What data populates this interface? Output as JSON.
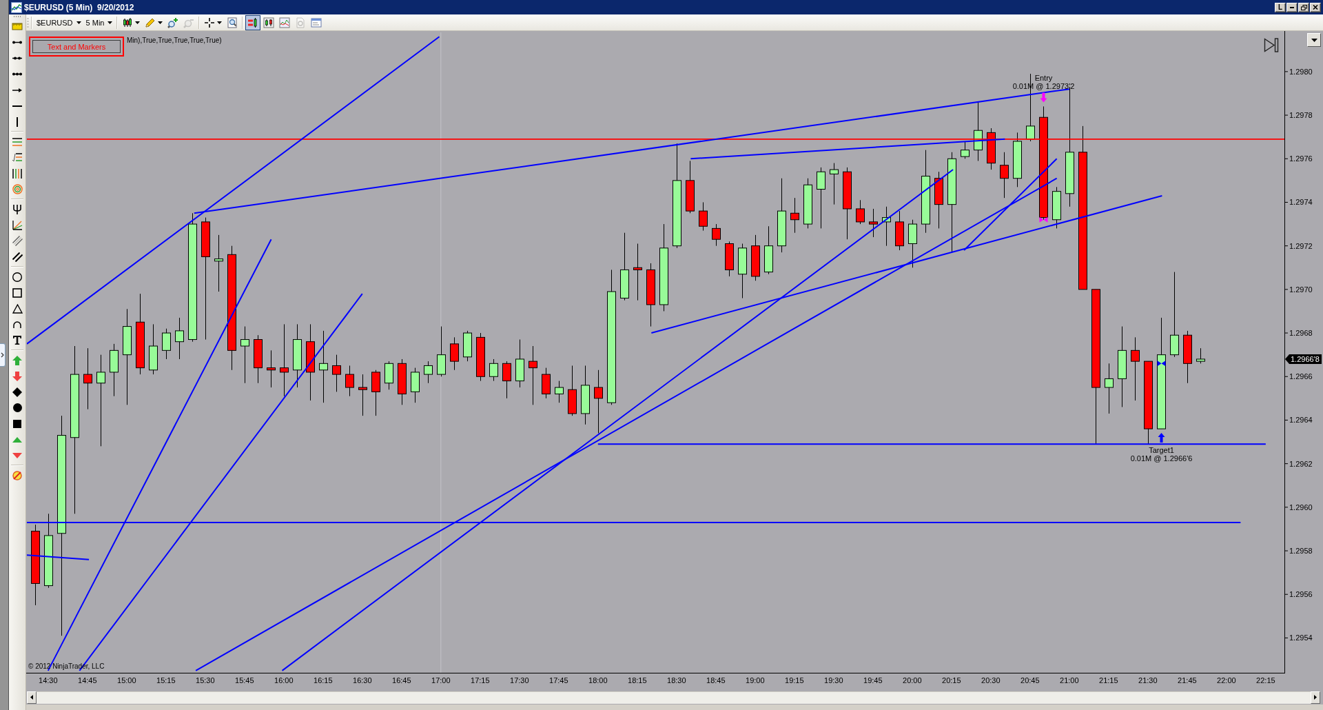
{
  "window": {
    "title": "$EURUSD (5 Min)  9/20/2012",
    "link_label": "L"
  },
  "toolbar": {
    "instrument": "$EURUSD",
    "interval": "5 Min",
    "tools": [
      {
        "kind": "chart-style",
        "selected": false,
        "disabled": false
      },
      {
        "kind": "drawing",
        "selected": false,
        "disabled": false
      },
      {
        "kind": "zoom-in",
        "selected": false,
        "disabled": false
      },
      {
        "kind": "zoom-out",
        "selected": false,
        "disabled": true
      },
      {
        "kind": "crosshair",
        "selected": false,
        "disabled": false
      },
      {
        "kind": "data-box",
        "selected": false,
        "disabled": false
      },
      {
        "kind": "chart-trader",
        "selected": true,
        "disabled": false
      },
      {
        "kind": "bars",
        "selected": false,
        "disabled": false
      },
      {
        "kind": "indicators",
        "selected": false,
        "disabled": false
      },
      {
        "kind": "strategies",
        "selected": false,
        "disabled": true
      },
      {
        "kind": "properties",
        "selected": false,
        "disabled": false
      }
    ]
  },
  "chart": {
    "button": {
      "label": "Text and Markers"
    },
    "copyright": "© 2012 NinjaTrader, LLC",
    "price_tag": "1.2966'8",
    "executions": [
      {
        "kind": "sell",
        "label": "Entry",
        "text": "0.01M @ 1.2973'2",
        "color": "#ff00ff"
      },
      {
        "kind": "buy",
        "label": "Target1",
        "text": "0.01M @ 1.2966'6",
        "color": "#0000ff"
      }
    ],
    "chart_data": {
      "type": "candlestick",
      "title": "Min),True,True,True,True,True)",
      "x": [
        14.4167,
        14.5,
        14.5833,
        14.6667,
        14.75,
        14.8333,
        14.9167,
        15,
        15.0833,
        15.1667,
        15.25,
        15.3333,
        15.4167,
        15.5,
        15.5833,
        15.6667,
        15.75,
        15.8333,
        15.9167,
        16,
        16.0833,
        16.1667,
        16.25,
        16.3333,
        16.4167,
        16.5,
        16.5833,
        16.6667,
        16.75,
        16.8333,
        16.9167,
        17,
        17.0833,
        17.1667,
        17.25,
        17.3333,
        17.4167,
        17.5,
        17.5833,
        17.6667,
        17.75,
        17.8333,
        17.9167,
        18,
        18.0833,
        18.1667,
        18.25,
        18.3333,
        18.4167,
        18.5,
        18.5833,
        18.6667,
        18.75,
        18.8333,
        18.9167,
        19,
        19.0833,
        19.1667,
        19.25,
        19.3333,
        19.4167,
        19.5,
        19.5833,
        19.6667,
        19.75,
        19.8333,
        19.9167,
        20,
        20.0833,
        20.1667,
        20.25,
        20.3333,
        20.4167,
        20.5,
        20.5833,
        20.6667,
        20.75,
        20.8333,
        20.9167,
        21,
        21.0833,
        21.1667,
        21.25,
        21.3333,
        21.4167,
        21.5,
        21.5833,
        21.6667,
        21.75,
        21.8333
      ],
      "ohlc": [
        [
          1.29589,
          1.29592,
          1.29555,
          1.29565
        ],
        [
          1.29564,
          1.29597,
          1.29563,
          1.29587
        ],
        [
          1.29588,
          1.29642,
          1.29541,
          1.29633
        ],
        [
          1.29632,
          1.29674,
          1.29597,
          1.29661
        ],
        [
          1.29661,
          1.29673,
          1.29645,
          1.29657
        ],
        [
          1.29657,
          1.2967,
          1.29628,
          1.29662
        ],
        [
          1.29662,
          1.29675,
          1.29651,
          1.29672
        ],
        [
          1.2967,
          1.29691,
          1.29647,
          1.29683
        ],
        [
          1.29685,
          1.29698,
          1.29661,
          1.29664
        ],
        [
          1.29663,
          1.29684,
          1.29661,
          1.29674
        ],
        [
          1.29672,
          1.29682,
          1.29668,
          1.2968
        ],
        [
          1.29676,
          1.29687,
          1.29668,
          1.29681
        ],
        [
          1.29677,
          1.29735,
          1.29676,
          1.2973
        ],
        [
          1.29731,
          1.29733,
          1.29677,
          1.29715
        ],
        [
          1.29713,
          1.29725,
          1.29699,
          1.29714
        ],
        [
          1.29716,
          1.2972,
          1.29663,
          1.29672
        ],
        [
          1.29674,
          1.29683,
          1.29657,
          1.29677
        ],
        [
          1.29677,
          1.29679,
          1.29657,
          1.29664
        ],
        [
          1.29664,
          1.29672,
          1.29655,
          1.29663
        ],
        [
          1.29664,
          1.29684,
          1.29651,
          1.29662
        ],
        [
          1.29663,
          1.29684,
          1.29655,
          1.29677
        ],
        [
          1.29676,
          1.29684,
          1.29649,
          1.29662
        ],
        [
          1.29663,
          1.29681,
          1.29648,
          1.29666
        ],
        [
          1.29665,
          1.2967,
          1.29653,
          1.29661
        ],
        [
          1.29661,
          1.29665,
          1.29651,
          1.29655
        ],
        [
          1.29655,
          1.29661,
          1.29642,
          1.29654
        ],
        [
          1.29662,
          1.29663,
          1.29642,
          1.29653
        ],
        [
          1.29657,
          1.29667,
          1.29654,
          1.29666
        ],
        [
          1.29666,
          1.29668,
          1.29647,
          1.29652
        ],
        [
          1.29653,
          1.29664,
          1.29648,
          1.29662
        ],
        [
          1.29661,
          1.29667,
          1.29657,
          1.29665
        ],
        [
          1.29661,
          1.29683,
          1.2966,
          1.2967
        ],
        [
          1.29675,
          1.29678,
          1.29663,
          1.29667
        ],
        [
          1.29669,
          1.29681,
          1.29667,
          1.2968
        ],
        [
          1.29678,
          1.2968,
          1.29658,
          1.2966
        ],
        [
          1.2966,
          1.29668,
          1.29658,
          1.29666
        ],
        [
          1.29666,
          1.29667,
          1.2965,
          1.29658
        ],
        [
          1.29658,
          1.29677,
          1.29655,
          1.29668
        ],
        [
          1.29667,
          1.29674,
          1.29647,
          1.29664
        ],
        [
          1.29661,
          1.29664,
          1.2965,
          1.29652
        ],
        [
          1.29652,
          1.29658,
          1.29648,
          1.29655
        ],
        [
          1.29654,
          1.29665,
          1.29642,
          1.29643
        ],
        [
          1.29643,
          1.29665,
          1.29638,
          1.29656
        ],
        [
          1.29655,
          1.29663,
          1.29634,
          1.2965
        ],
        [
          1.29648,
          1.29709,
          1.29647,
          1.29699
        ],
        [
          1.29696,
          1.29726,
          1.29695,
          1.29709
        ],
        [
          1.2971,
          1.29721,
          1.29695,
          1.29709
        ],
        [
          1.29709,
          1.29712,
          1.29683,
          1.29693
        ],
        [
          1.29693,
          1.2973,
          1.2969,
          1.29719
        ],
        [
          1.2972,
          1.29767,
          1.29719,
          1.2975
        ],
        [
          1.2975,
          1.29759,
          1.29735,
          1.29736
        ],
        [
          1.29736,
          1.2974,
          1.29727,
          1.29729
        ],
        [
          1.29728,
          1.2973,
          1.2972,
          1.29723
        ],
        [
          1.29721,
          1.29722,
          1.29706,
          1.29709
        ],
        [
          1.29707,
          1.29721,
          1.29696,
          1.29719
        ],
        [
          1.2972,
          1.29725,
          1.29704,
          1.29706
        ],
        [
          1.29708,
          1.29729,
          1.29707,
          1.2972
        ],
        [
          1.2972,
          1.29751,
          1.29717,
          1.29736
        ],
        [
          1.29735,
          1.29742,
          1.29726,
          1.29732
        ],
        [
          1.2973,
          1.29751,
          1.29728,
          1.29748
        ],
        [
          1.29746,
          1.29756,
          1.29728,
          1.29754
        ],
        [
          1.29753,
          1.29758,
          1.29739,
          1.29755
        ],
        [
          1.29754,
          1.29756,
          1.29723,
          1.29737
        ],
        [
          1.29737,
          1.29741,
          1.2973,
          1.29731
        ],
        [
          1.29731,
          1.29737,
          1.29724,
          1.2973
        ],
        [
          1.29731,
          1.29738,
          1.2972,
          1.29733
        ],
        [
          1.29731,
          1.29736,
          1.29718,
          1.2972
        ],
        [
          1.29721,
          1.29732,
          1.2971,
          1.2973
        ],
        [
          1.2973,
          1.29764,
          1.29726,
          1.29752
        ],
        [
          1.29751,
          1.29754,
          1.29728,
          1.29739
        ],
        [
          1.29739,
          1.29763,
          1.29717,
          1.2976
        ],
        [
          1.29761,
          1.29768,
          1.2976,
          1.29764
        ],
        [
          1.29764,
          1.29786,
          1.29759,
          1.29773
        ],
        [
          1.29772,
          1.29774,
          1.29755,
          1.29758
        ],
        [
          1.29757,
          1.29763,
          1.29742,
          1.29751
        ],
        [
          1.29751,
          1.29772,
          1.29747,
          1.29768
        ],
        [
          1.29769,
          1.29799,
          1.29768,
          1.29775
        ],
        [
          1.29779,
          1.29784,
          1.29732,
          1.29733
        ],
        [
          1.29732,
          1.29747,
          1.29728,
          1.29745
        ],
        [
          1.29744,
          1.29793,
          1.29738,
          1.29763
        ],
        [
          1.29763,
          1.29775,
          1.297,
          1.297
        ],
        [
          1.297,
          1.297,
          1.29629,
          1.29655
        ],
        [
          1.29655,
          1.29666,
          1.29643,
          1.29659
        ],
        [
          1.29659,
          1.29683,
          1.29646,
          1.29672
        ],
        [
          1.29672,
          1.29678,
          1.29649,
          1.29667
        ],
        [
          1.29667,
          1.29667,
          1.29629,
          1.29636
        ],
        [
          1.29636,
          1.29687,
          1.29636,
          1.2967
        ],
        [
          1.2967,
          1.29708,
          1.29669,
          1.29679
        ],
        [
          1.29679,
          1.29681,
          1.29657,
          1.29666
        ],
        [
          1.29667,
          1.29673,
          1.29666,
          1.29668
        ]
      ],
      "xlim": [
        14.365,
        22.369
      ],
      "ylim": [
        1.29524,
        1.29818
      ],
      "xticks": [
        {
          "value": 14.5,
          "label": "14:30"
        },
        {
          "value": 14.75,
          "label": "14:45"
        },
        {
          "value": 15,
          "label": "15:00"
        },
        {
          "value": 15.25,
          "label": "15:15"
        },
        {
          "value": 15.5,
          "label": "15:30"
        },
        {
          "value": 15.75,
          "label": "15:45"
        },
        {
          "value": 16,
          "label": "16:00"
        },
        {
          "value": 16.25,
          "label": "16:15"
        },
        {
          "value": 16.5,
          "label": "16:30"
        },
        {
          "value": 16.75,
          "label": "16:45"
        },
        {
          "value": 17,
          "label": "17:00"
        },
        {
          "value": 17.25,
          "label": "17:15"
        },
        {
          "value": 17.5,
          "label": "17:30"
        },
        {
          "value": 17.75,
          "label": "17:45"
        },
        {
          "value": 18,
          "label": "18:00"
        },
        {
          "value": 18.25,
          "label": "18:15"
        },
        {
          "value": 18.5,
          "label": "18:30"
        },
        {
          "value": 18.75,
          "label": "18:45"
        },
        {
          "value": 19,
          "label": "19:00"
        },
        {
          "value": 19.25,
          "label": "19:15"
        },
        {
          "value": 19.5,
          "label": "19:30"
        },
        {
          "value": 19.75,
          "label": "19:45"
        },
        {
          "value": 20,
          "label": "20:00"
        },
        {
          "value": 20.25,
          "label": "20:15"
        },
        {
          "value": 20.5,
          "label": "20:30"
        },
        {
          "value": 20.75,
          "label": "20:45"
        },
        {
          "value": 21,
          "label": "21:00"
        },
        {
          "value": 21.25,
          "label": "21:15"
        },
        {
          "value": 21.5,
          "label": "21:30"
        },
        {
          "value": 21.75,
          "label": "21:45"
        },
        {
          "value": 22,
          "label": "22:00"
        },
        {
          "value": 22.25,
          "label": "22:15"
        }
      ],
      "yticks": [
        {
          "value": 1.298,
          "label": "1.2980"
        },
        {
          "value": 1.2978,
          "label": "1.2978"
        },
        {
          "value": 1.2976,
          "label": "1.2976"
        },
        {
          "value": 1.2974,
          "label": "1.2974"
        },
        {
          "value": 1.2972,
          "label": "1.2972"
        },
        {
          "value": 1.297,
          "label": "1.2970"
        },
        {
          "value": 1.2968,
          "label": "1.2968"
        },
        {
          "value": 1.2966,
          "label": "1.2966"
        },
        {
          "value": 1.2964,
          "label": "1.2964"
        },
        {
          "value": 1.2962,
          "label": "1.2962"
        },
        {
          "value": 1.296,
          "label": "1.2960"
        },
        {
          "value": 1.2958,
          "label": "1.2958"
        },
        {
          "value": 1.2956,
          "label": "1.2956"
        },
        {
          "value": 1.2954,
          "label": "1.2954"
        }
      ],
      "series": [
        {
          "type": "line",
          "color": "#0000ff",
          "x": [
            14.365,
            16.99
          ],
          "values": [
            1.29675,
            1.29816
          ]
        },
        {
          "type": "line",
          "color": "#0000ff",
          "x": [
            15.43,
            21.0
          ],
          "values": [
            1.29735,
            1.29792
          ]
        },
        {
          "type": "line",
          "color": "#0000ff",
          "x": [
            18.59,
            20.59
          ],
          "values": [
            1.2976,
            1.29769
          ]
        },
        {
          "type": "line",
          "color": "#0000ff",
          "x": [
            18.34,
            21.59
          ],
          "values": [
            1.2968,
            1.29743
          ]
        },
        {
          "type": "line",
          "color": "#0000ff",
          "x": [
            14.5,
            15.92
          ],
          "values": [
            1.29525,
            1.29723
          ]
        },
        {
          "type": "line",
          "color": "#0000ff",
          "x": [
            14.7,
            16.5
          ],
          "values": [
            1.29525,
            1.29698
          ]
        },
        {
          "type": "line",
          "color": "#0000ff",
          "x": [
            15.44,
            20.92
          ],
          "values": [
            1.29525,
            1.29751
          ]
        },
        {
          "type": "line",
          "color": "#0000ff",
          "x": [
            15.99,
            20.26
          ],
          "values": [
            1.29525,
            1.29755
          ]
        },
        {
          "type": "line",
          "color": "#0000ff",
          "x": [
            20.33,
            20.92
          ],
          "values": [
            1.29718,
            1.2976
          ]
        },
        {
          "type": "line",
          "color": "#0000ff",
          "x": [
            14.365,
            14.76
          ],
          "values": [
            1.29578,
            1.29576
          ]
        },
        {
          "type": "line",
          "color": "#0000ff",
          "x": [
            18.0,
            22.25
          ],
          "values": [
            1.29629,
            1.29629
          ]
        },
        {
          "type": "line",
          "color": "#0000ff",
          "x": [
            14.365,
            22.09
          ],
          "values": [
            1.29593,
            1.29593
          ]
        }
      ],
      "ref_lines": [
        {
          "axis": "x",
          "value": 17,
          "color": "#c4c4c8"
        },
        {
          "axis": "y",
          "value": 1.29769,
          "color": "#ff0000"
        }
      ]
    }
  }
}
